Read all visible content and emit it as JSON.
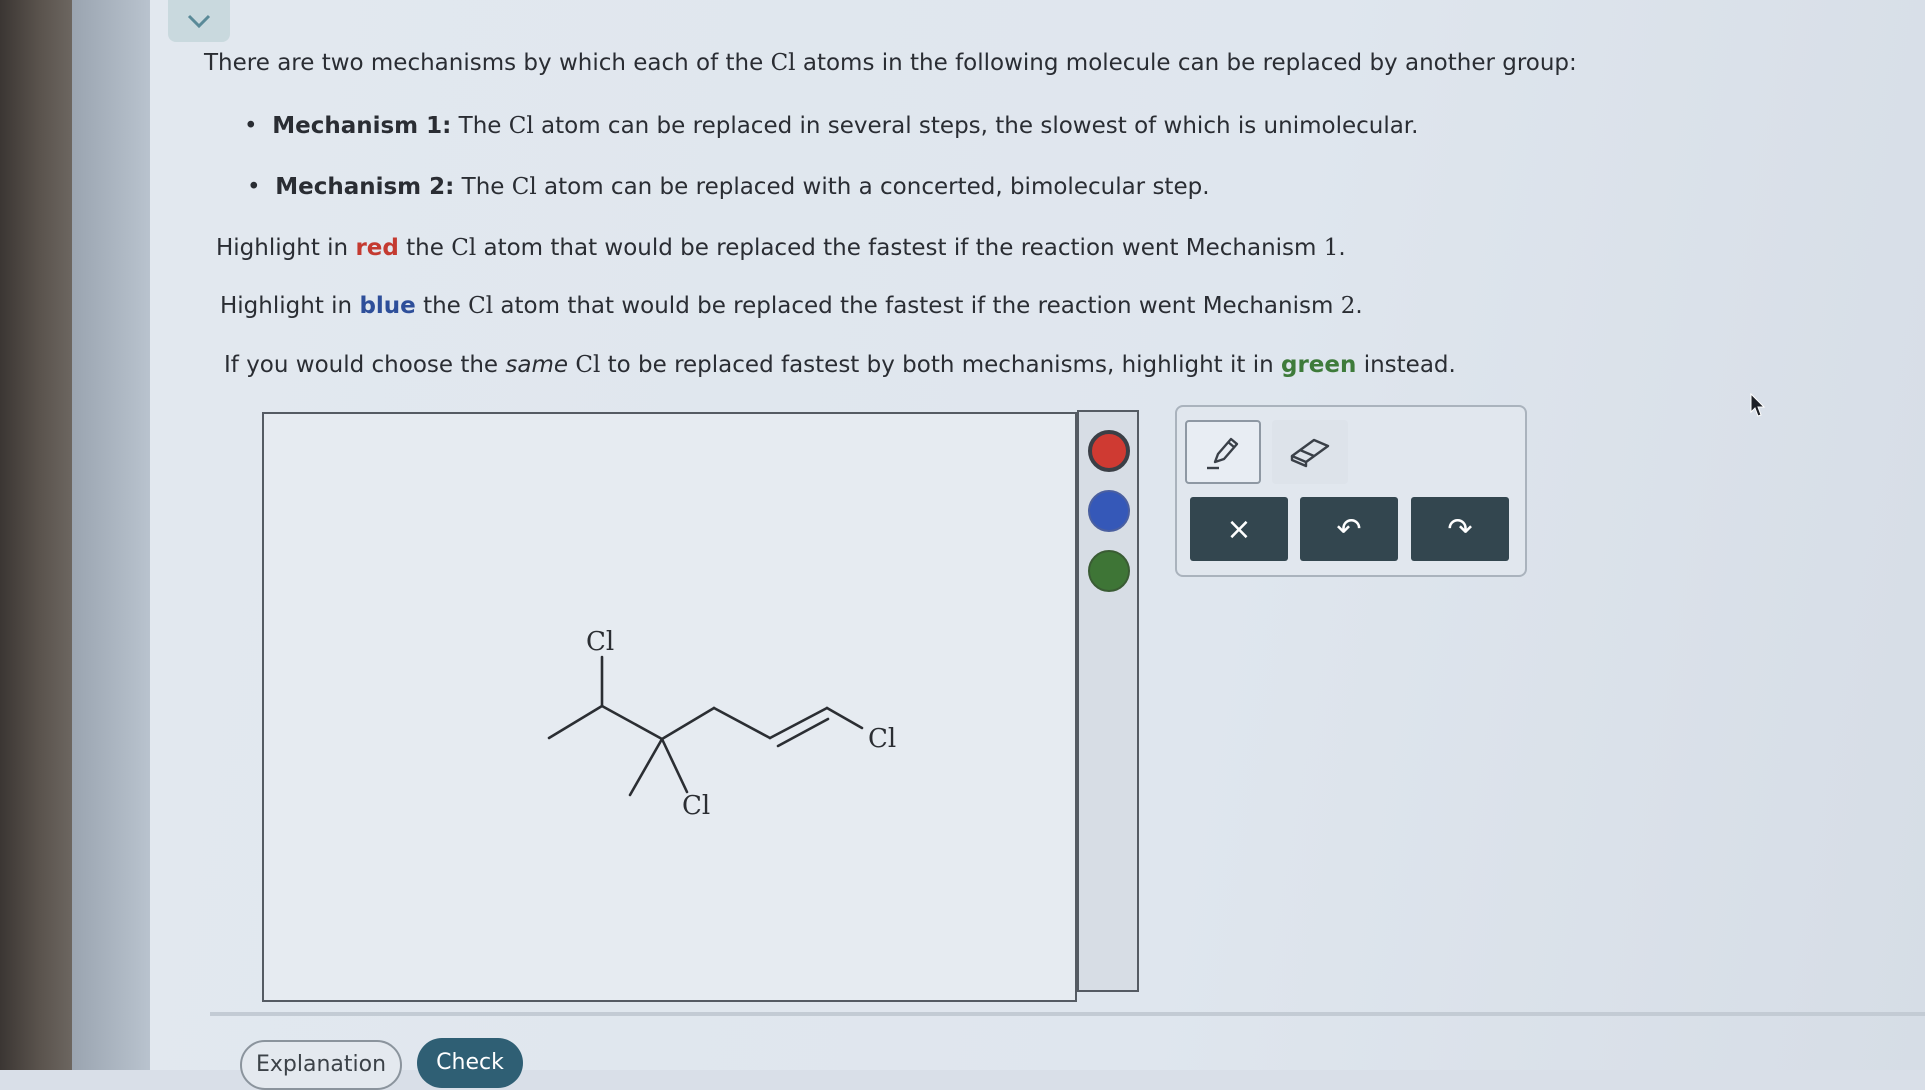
{
  "intro": {
    "part1": "There are two mechanisms by which each of the ",
    "cl": "Cl",
    "part2": " atoms in the following molecule can be replaced by another group:"
  },
  "mechanisms": [
    {
      "label": "Mechanism 1:",
      "part1": " The ",
      "cl": "Cl",
      "part2": " atom can be replaced in several steps, the slowest of which is unimolecular."
    },
    {
      "label": "Mechanism 2:",
      "part1": " The ",
      "cl": "Cl",
      "part2": " atom can be replaced with a concerted, bimolecular step."
    }
  ],
  "instructions": {
    "red": {
      "pre": "Highlight in ",
      "color_word": "red",
      "mid": " the ",
      "cl": "Cl",
      "post": " atom that would be replaced the fastest if the reaction went Mechanism ",
      "num": "1",
      "end": "."
    },
    "blue": {
      "pre": "Highlight in ",
      "color_word": "blue",
      "mid": " the ",
      "cl": "Cl",
      "post": " atom that would be replaced the fastest if the reaction went Mechanism ",
      "num": "2",
      "end": "."
    },
    "green": {
      "pre": "If you would choose the ",
      "italic": "same",
      "cl": "Cl",
      "mid": " to be replaced fastest by both mechanisms, highlight it in ",
      "color_word": "green",
      "post": " instead."
    }
  },
  "molecule": {
    "atom_labels": [
      "Cl",
      "Cl",
      "Cl"
    ]
  },
  "palette": {
    "colors": [
      "#cf3a32",
      "#3558b8",
      "#3e7536"
    ]
  },
  "toolbar": {
    "pencil_icon": "pencil-icon",
    "eraser_icon": "eraser-icon",
    "clear_label": "×",
    "undo_label": "↶",
    "redo_label": "↷"
  },
  "footer": {
    "explanation_label": "Explanation",
    "check_label": "Check"
  }
}
